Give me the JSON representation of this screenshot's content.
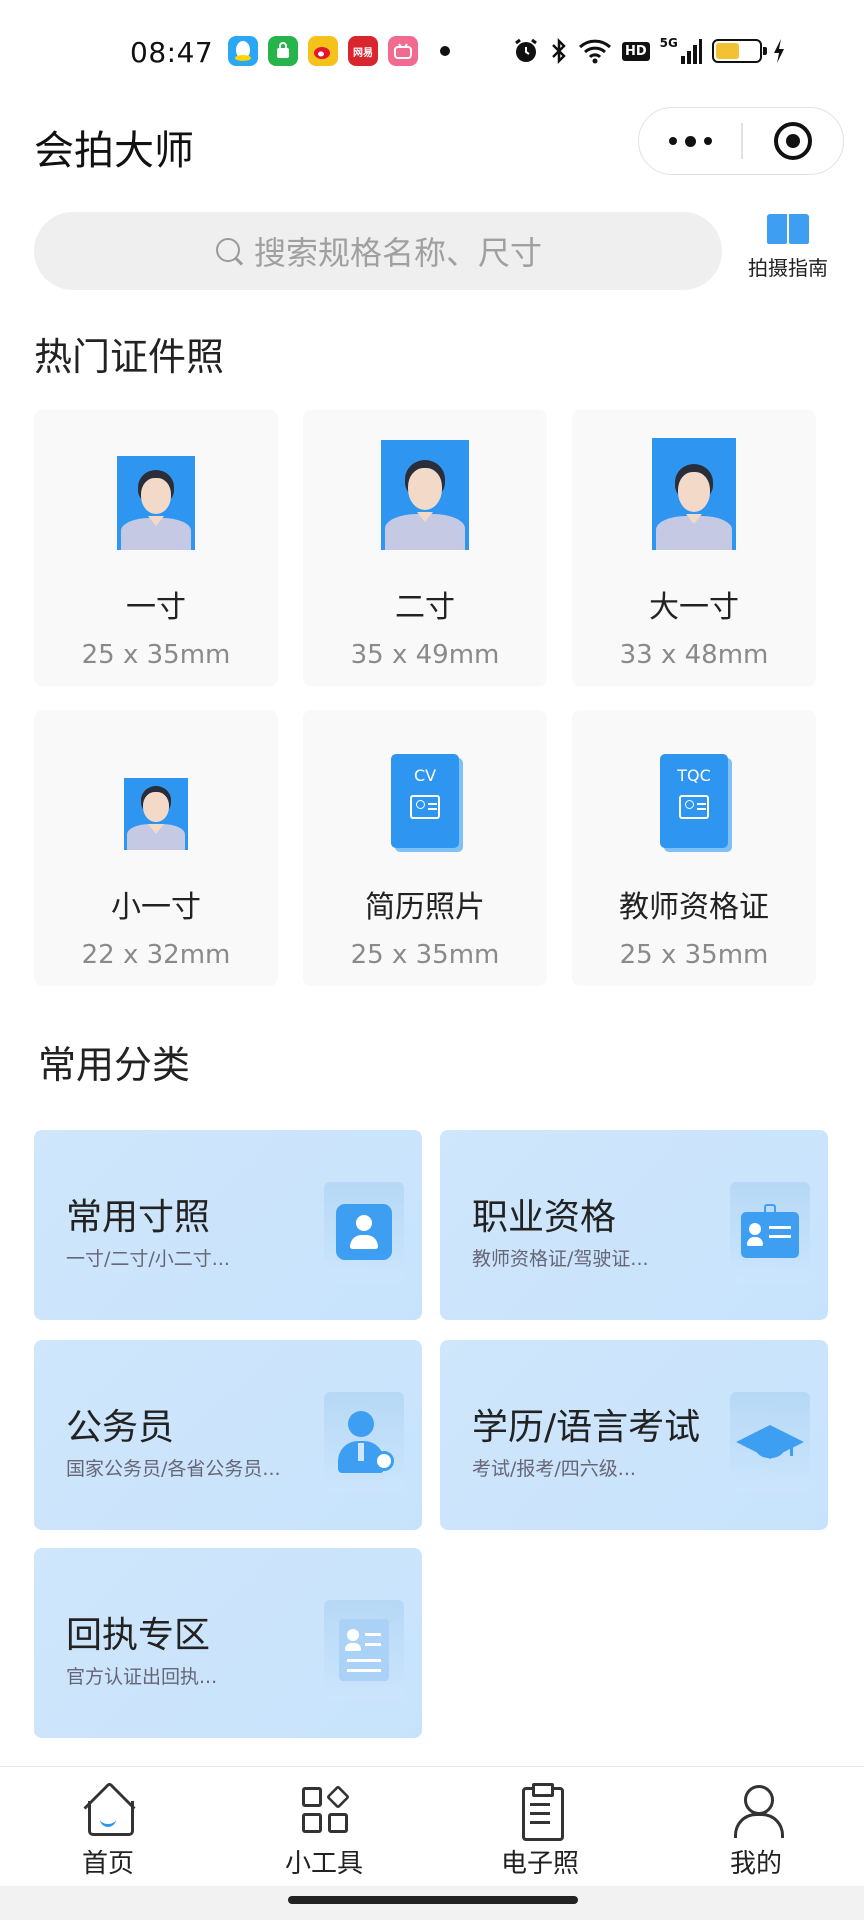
{
  "status_bar": {
    "time": "08:47",
    "notifications": [
      {
        "name": "qq-icon",
        "color": "#2aa7f5"
      },
      {
        "name": "shop-icon",
        "color": "#27b54b"
      },
      {
        "name": "weibo-icon",
        "color": "#f5c21a"
      },
      {
        "name": "netease-icon",
        "color": "#d9252e",
        "label": "网易"
      },
      {
        "name": "bilibili-icon",
        "color": "#f06b8f"
      }
    ],
    "hd_label": "HD",
    "network_label": "5G",
    "battery_level": 0.55
  },
  "header": {
    "title": "会拍大师"
  },
  "search": {
    "placeholder": "搜索规格名称、尺寸",
    "guide_label": "拍摄指南"
  },
  "hot": {
    "title": "热门证件照",
    "items": [
      {
        "name": "一寸",
        "size": "25 x 35mm",
        "icon": "portrait"
      },
      {
        "name": "二寸",
        "size": "35 x 49mm",
        "icon": "portrait"
      },
      {
        "name": "大一寸",
        "size": "33 x 48mm",
        "icon": "portrait"
      },
      {
        "name": "小一寸",
        "size": "22 x 32mm",
        "icon": "portrait"
      },
      {
        "name": "简历照片",
        "size": "25 x 35mm",
        "icon": "cv-doc",
        "doc_text": "CV"
      },
      {
        "name": "教师资格证",
        "size": "25 x 35mm",
        "icon": "tqc-doc",
        "doc_text": "TQC"
      }
    ]
  },
  "categories": {
    "title": "常用分类",
    "items": [
      {
        "title": "常用寸照",
        "subtitle": "一寸/二寸/小二寸...",
        "icon": "user-card-icon"
      },
      {
        "title": "职业资格",
        "subtitle": "教师资格证/驾驶证...",
        "icon": "badge-icon"
      },
      {
        "title": "公务员",
        "subtitle": "国家公务员/各省公务员...",
        "icon": "official-icon"
      },
      {
        "title": "学历/语言考试",
        "subtitle": "考试/报考/四六级...",
        "icon": "graduation-cap-icon"
      },
      {
        "title": "回执专区",
        "subtitle": "官方认证出回执...",
        "icon": "receipt-icon"
      }
    ]
  },
  "bottom_nav": {
    "items": [
      {
        "label": "首页",
        "icon": "home-icon"
      },
      {
        "label": "小工具",
        "icon": "tools-icon"
      },
      {
        "label": "电子照",
        "icon": "e-photo-icon"
      },
      {
        "label": "我的",
        "icon": "profile-icon"
      }
    ]
  },
  "colors": {
    "accent": "#2e96f0",
    "card_bg": "#cfe6fb"
  }
}
